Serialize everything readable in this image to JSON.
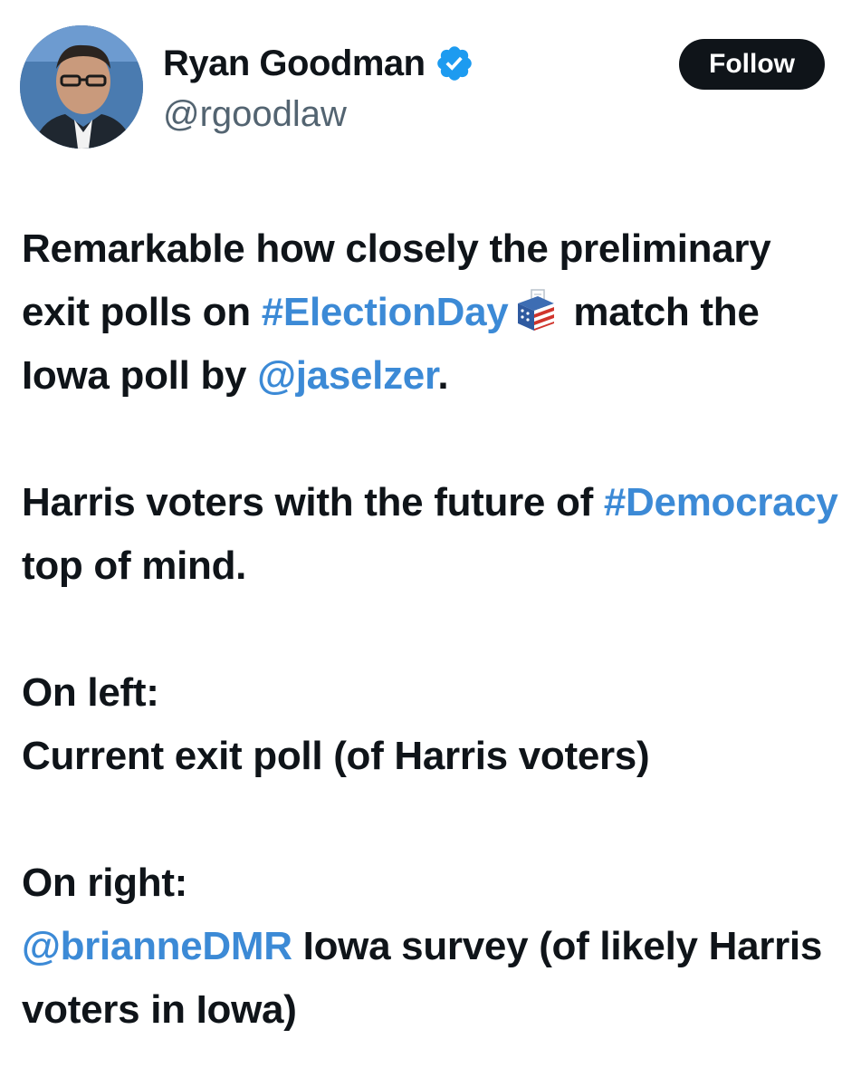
{
  "author": {
    "display_name": "Ryan Goodman",
    "handle": "@rgoodlaw",
    "verified": true,
    "avatar_icon": "profile-photo"
  },
  "actions": {
    "follow_label": "Follow"
  },
  "tweet": {
    "p1": {
      "t1": "Remarkable how closely the preliminary exit polls on ",
      "hashtag1": "#ElectionDay",
      "emoji_icon": "ballot-box-icon",
      "t2": " match the Iowa poll by ",
      "mention1": "@jaselzer",
      "t3": "."
    },
    "p2": {
      "t1": "Harris voters with the future of ",
      "hashtag2": "#Democracy",
      "t2": " top of mind."
    },
    "p3": {
      "line1": "On left:",
      "line2": "Current exit poll (of Harris voters)"
    },
    "p4": {
      "line1": "On right:",
      "mention2": "@brianneDMR",
      "t2": " Iowa survey (of likely Harris voters in Iowa)"
    }
  },
  "colors": {
    "link": "#3c8ad6",
    "text": "#0f1419",
    "secondary": "#536471",
    "verified": "#1d9bf0",
    "follow_bg": "#0f1419"
  }
}
